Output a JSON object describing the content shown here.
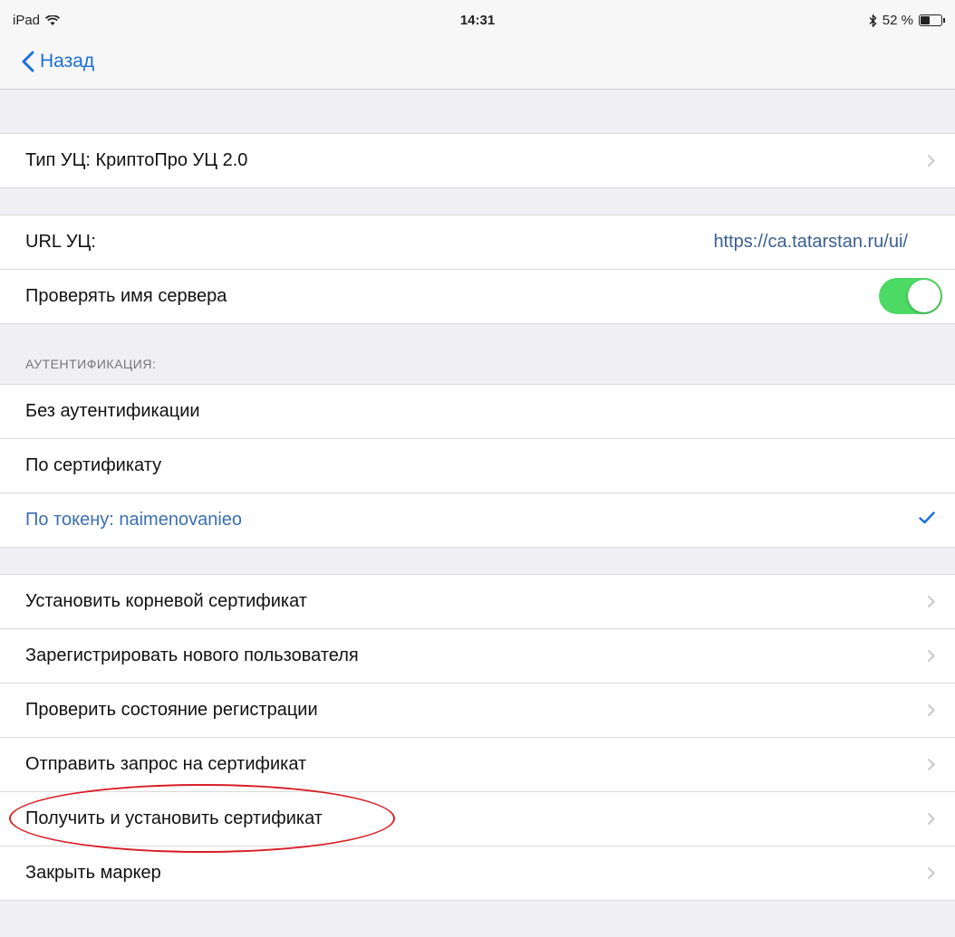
{
  "status_bar": {
    "device": "iPad",
    "time": "14:31",
    "battery_text": "52 %",
    "battery_level": 0.52
  },
  "nav": {
    "back_label": "Назад"
  },
  "ca_type": {
    "label": "Тип УЦ: КриптоПро УЦ 2.0"
  },
  "ca_url": {
    "label": "URL УЦ:",
    "value": "https://ca.tatarstan.ru/ui/"
  },
  "verify_server": {
    "label": "Проверять имя сервера",
    "enabled": true,
    "on_color": "#4cd964"
  },
  "auth": {
    "header": "АУТЕНТИФИКАЦИЯ:",
    "options": [
      {
        "label": "Без аутентификации",
        "selected": false
      },
      {
        "label": "По сертификату",
        "selected": false
      },
      {
        "label": "По токену: naimenovanieo",
        "selected": true
      }
    ]
  },
  "actions": [
    {
      "label": "Установить корневой сертификат"
    },
    {
      "label": "Зарегистрировать нового пользователя"
    },
    {
      "label": "Проверить состояние регистрации"
    },
    {
      "label": "Отправить запрос на сертификат"
    },
    {
      "label": "Получить и установить сертификат",
      "highlighted": true
    },
    {
      "label": "Закрыть маркер"
    }
  ],
  "colors": {
    "accent": "#1a6fd8",
    "highlight_circle": "#d81f26",
    "group_background": "#efeff4"
  }
}
